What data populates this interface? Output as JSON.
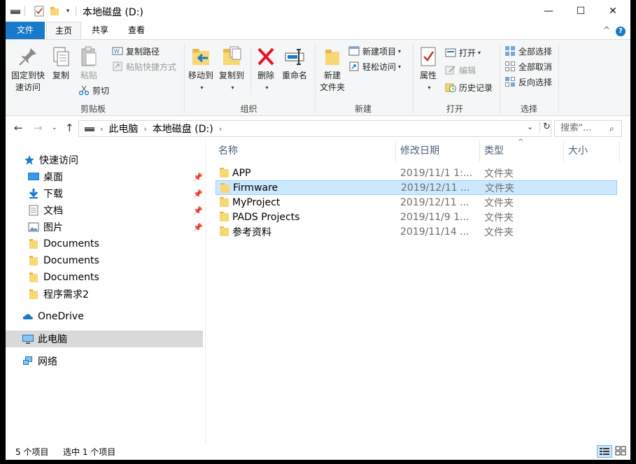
{
  "titlebar": {
    "title": "本地磁盘 (D:)",
    "minimize": "—",
    "maximize": "☐",
    "close": "✕"
  },
  "tabs": {
    "file": "文件",
    "home": "主页",
    "share": "共享",
    "view": "查看",
    "collapse": "^"
  },
  "ribbon": {
    "clipboard": {
      "label": "剪贴板",
      "pin_quick_access_line1": "固定到快",
      "pin_quick_access_line2": "速访问",
      "copy": "复制",
      "paste": "粘贴",
      "copy_path": "复制路径",
      "paste_shortcut": "粘贴快捷方式",
      "cut": "剪切"
    },
    "organize": {
      "label": "组织",
      "move_to": "移动到",
      "copy_to": "复制到",
      "delete": "删除",
      "rename": "重命名"
    },
    "new": {
      "label": "新建",
      "new_folder_line1": "新建",
      "new_folder_line2": "文件夹",
      "new_item": "新建项目",
      "easy_access": "轻松访问"
    },
    "open": {
      "label": "打开",
      "properties": "属性",
      "open": "打开",
      "edit": "编辑",
      "history": "历史记录"
    },
    "select": {
      "label": "选择",
      "select_all": "全部选择",
      "select_none": "全部取消",
      "invert": "反向选择"
    }
  },
  "address": {
    "crumbs": [
      "此电脑",
      "本地磁盘 (D:)"
    ],
    "search_placeholder": "搜索\"..."
  },
  "nav": {
    "quick_access": "快速访问",
    "items": [
      "桌面",
      "下载",
      "文档",
      "图片",
      "Documents",
      "Documents",
      "Documents",
      "程序需求2"
    ],
    "onedrive": "OneDrive",
    "this_pc": "此电脑",
    "network": "网络"
  },
  "columns": {
    "name": "名称",
    "modified": "修改日期",
    "type": "类型",
    "size": "大小"
  },
  "files": [
    {
      "name": "APP",
      "date": "2019/11/1 1:...",
      "type": "文件夹"
    },
    {
      "name": "Firmware",
      "date": "2019/12/11 ...",
      "type": "文件夹"
    },
    {
      "name": "MyProject",
      "date": "2019/12/11 ...",
      "type": "文件夹"
    },
    {
      "name": "PADS Projects",
      "date": "2019/11/9 1...",
      "type": "文件夹"
    },
    {
      "name": "参考资料",
      "date": "2019/11/14 ...",
      "type": "文件夹"
    }
  ],
  "status": {
    "count": "5 个项目",
    "selected": "选中 1 个项目"
  },
  "colors": {
    "accent": "#1979ca",
    "selection": "#cce8ff",
    "folder": "#f8d775"
  }
}
